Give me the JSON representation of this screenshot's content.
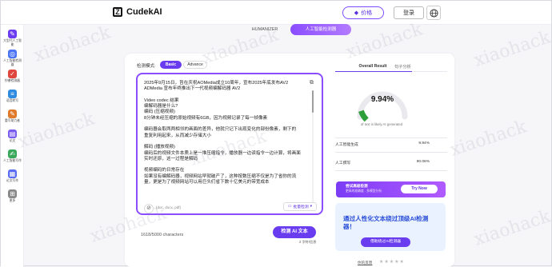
{
  "app": {
    "name": "CudekAI"
  },
  "header": {
    "price_label": "价格",
    "login_label": "登录"
  },
  "sidebar": {
    "items": [
      {
        "label": "大型代人工智能",
        "color": "#6c3df0"
      },
      {
        "label": "人工智能检测器",
        "color": "#4a73f5"
      },
      {
        "label": "抄袭检测器",
        "color": "#e0463d"
      },
      {
        "label": "语音转写",
        "color": "#2f8be0"
      },
      {
        "label": "重写助力者",
        "color": "#e07a2a"
      },
      {
        "label": "论文",
        "color": "#7a5cf0"
      },
      {
        "label": "人工智能写作",
        "color": "#3aa85a"
      },
      {
        "label": "论文写作",
        "color": "#5a6cf0"
      },
      {
        "label": "更多",
        "color": "#888888"
      }
    ]
  },
  "tabs": {
    "humanizer": "HUMANIZER",
    "detector": "人工智能检测器"
  },
  "detector": {
    "mode_label": "检测模式:",
    "mode_basic": "Basic",
    "mode_advanced": "Advance",
    "input_text": "2025年9月15日，旨在庆祝AOMedia成立10周年，宣布2025年底发布AV2\nADMedia 宣布年终推出下一代视频编解码器 AV2\n\nVideo codec 结果\n编解码器是什么?\n编码 (压缩视频)\n8分钟未经压缩的原始视频有6GB，因为视频记录了每一帧像素\n\n编码器会取两两相邻的画面的差异，他就只记下出现变化的部份像素，剩下的\n重复利用起来，从而减少存储大小\n\n解码 (播放视频)\n编码后的视频文件本质上是一堆压缩指令，播放器一边读指令一边计算，将画面\n实时还原，这一过程是解码\n\n视频编码的日常存在\n如果没有编解码器，视频网站早就破产了，这种按数压缩不仅是为了省你的流\n量，更是为了视频网站可以用巨头们省下数十亿美元的带宽成本",
    "file_hint": "(doc, docx, pdf)",
    "batch_label": "批量检测",
    "char_count": "1618/5000 characters",
    "detect_button": "检测 AI 文本",
    "cost_note": "2 字符/信息"
  },
  "results": {
    "tab_overall": "Overall Result",
    "tab_sentence": "句子分析",
    "score_display": "9.94%",
    "score_fraction": 0.0994,
    "score_caption": "of text is likely AI generated",
    "stats": [
      {
        "label": "人工智能生成",
        "value": "9.94%"
      },
      {
        "label": "人工撰写",
        "value": "90.06%"
      }
    ],
    "gauge_color": "#2e9e3a"
  },
  "upgrade": {
    "title": "尝试高级检测",
    "subtitle": "更高的准确度 - 多模型分析",
    "button": "Try Now"
  },
  "promo": {
    "title": "通过人性化文本绕过顶级AI检测器！",
    "button": "借助绕过AI检测器"
  },
  "rating": {
    "label": "你的反馈",
    "stars": "★★★★★"
  },
  "watermark": "xiaohack"
}
